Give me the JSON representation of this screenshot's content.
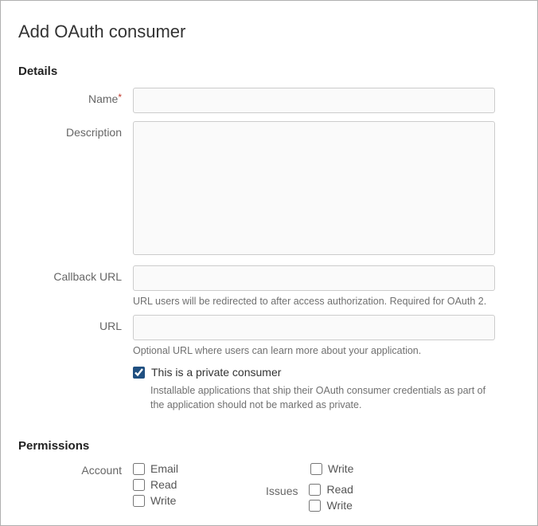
{
  "title": "Add OAuth consumer",
  "sections": {
    "details": {
      "heading": "Details",
      "name": {
        "label": "Name",
        "required": true,
        "value": ""
      },
      "description": {
        "label": "Description",
        "value": ""
      },
      "callback": {
        "label": "Callback URL",
        "value": "",
        "help": "URL users will be redirected to after access authorization. Required for OAuth 2."
      },
      "url": {
        "label": "URL",
        "value": "",
        "help": "Optional URL where users can learn more about your application."
      },
      "private": {
        "checked": true,
        "label": "This is a private consumer",
        "help": "Installable applications that ship their OAuth consumer credentials as part of the application should not be marked as private."
      }
    },
    "permissions": {
      "heading": "Permissions",
      "account": {
        "label": "Account",
        "options": [
          {
            "label": "Email",
            "checked": false
          },
          {
            "label": "Read",
            "checked": false
          },
          {
            "label": "Write",
            "checked": false
          }
        ]
      },
      "col2_top": {
        "label": "Write",
        "checked": false
      },
      "issues": {
        "label": "Issues",
        "options": [
          {
            "label": "Read",
            "checked": false
          },
          {
            "label": "Write",
            "checked": false
          }
        ]
      }
    }
  }
}
